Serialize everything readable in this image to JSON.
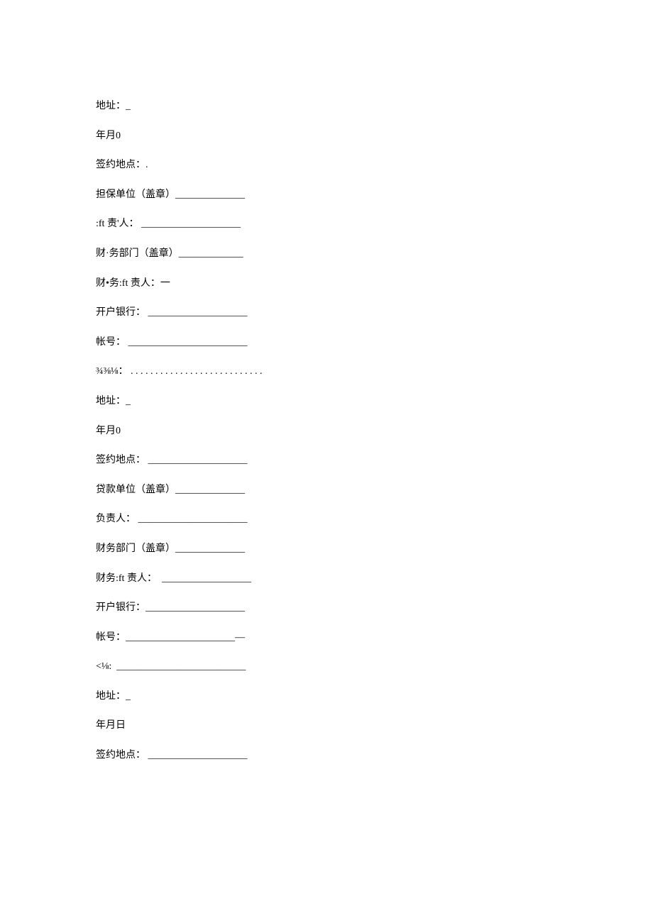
{
  "lines": [
    "地址：_",
    "年月0",
    "签约地点：.",
    "担保单位（盖章）______________",
    ":ft 责'人： ____________________",
    "财·务部门（盖章）_____________",
    "财•务:ft 责人：一",
    "开户银行： ____________________",
    "帐号： ________________________",
    "¾⅜⅛： . . . . . . . . . . . . . . . . . . . . . . . . . . .",
    "地址：_",
    "年月0",
    "签约地点： ____________________",
    "贷款单位（盖章）______________",
    "负责人： ______________________",
    "财务部门（盖章）______________",
    "财务:ft 责人：  __________________",
    "开户银行：____________________",
    "帐号：______________________—",
    "<⅛:  __________________________",
    "地址：_",
    "年月日",
    "签约地点： ____________________"
  ]
}
